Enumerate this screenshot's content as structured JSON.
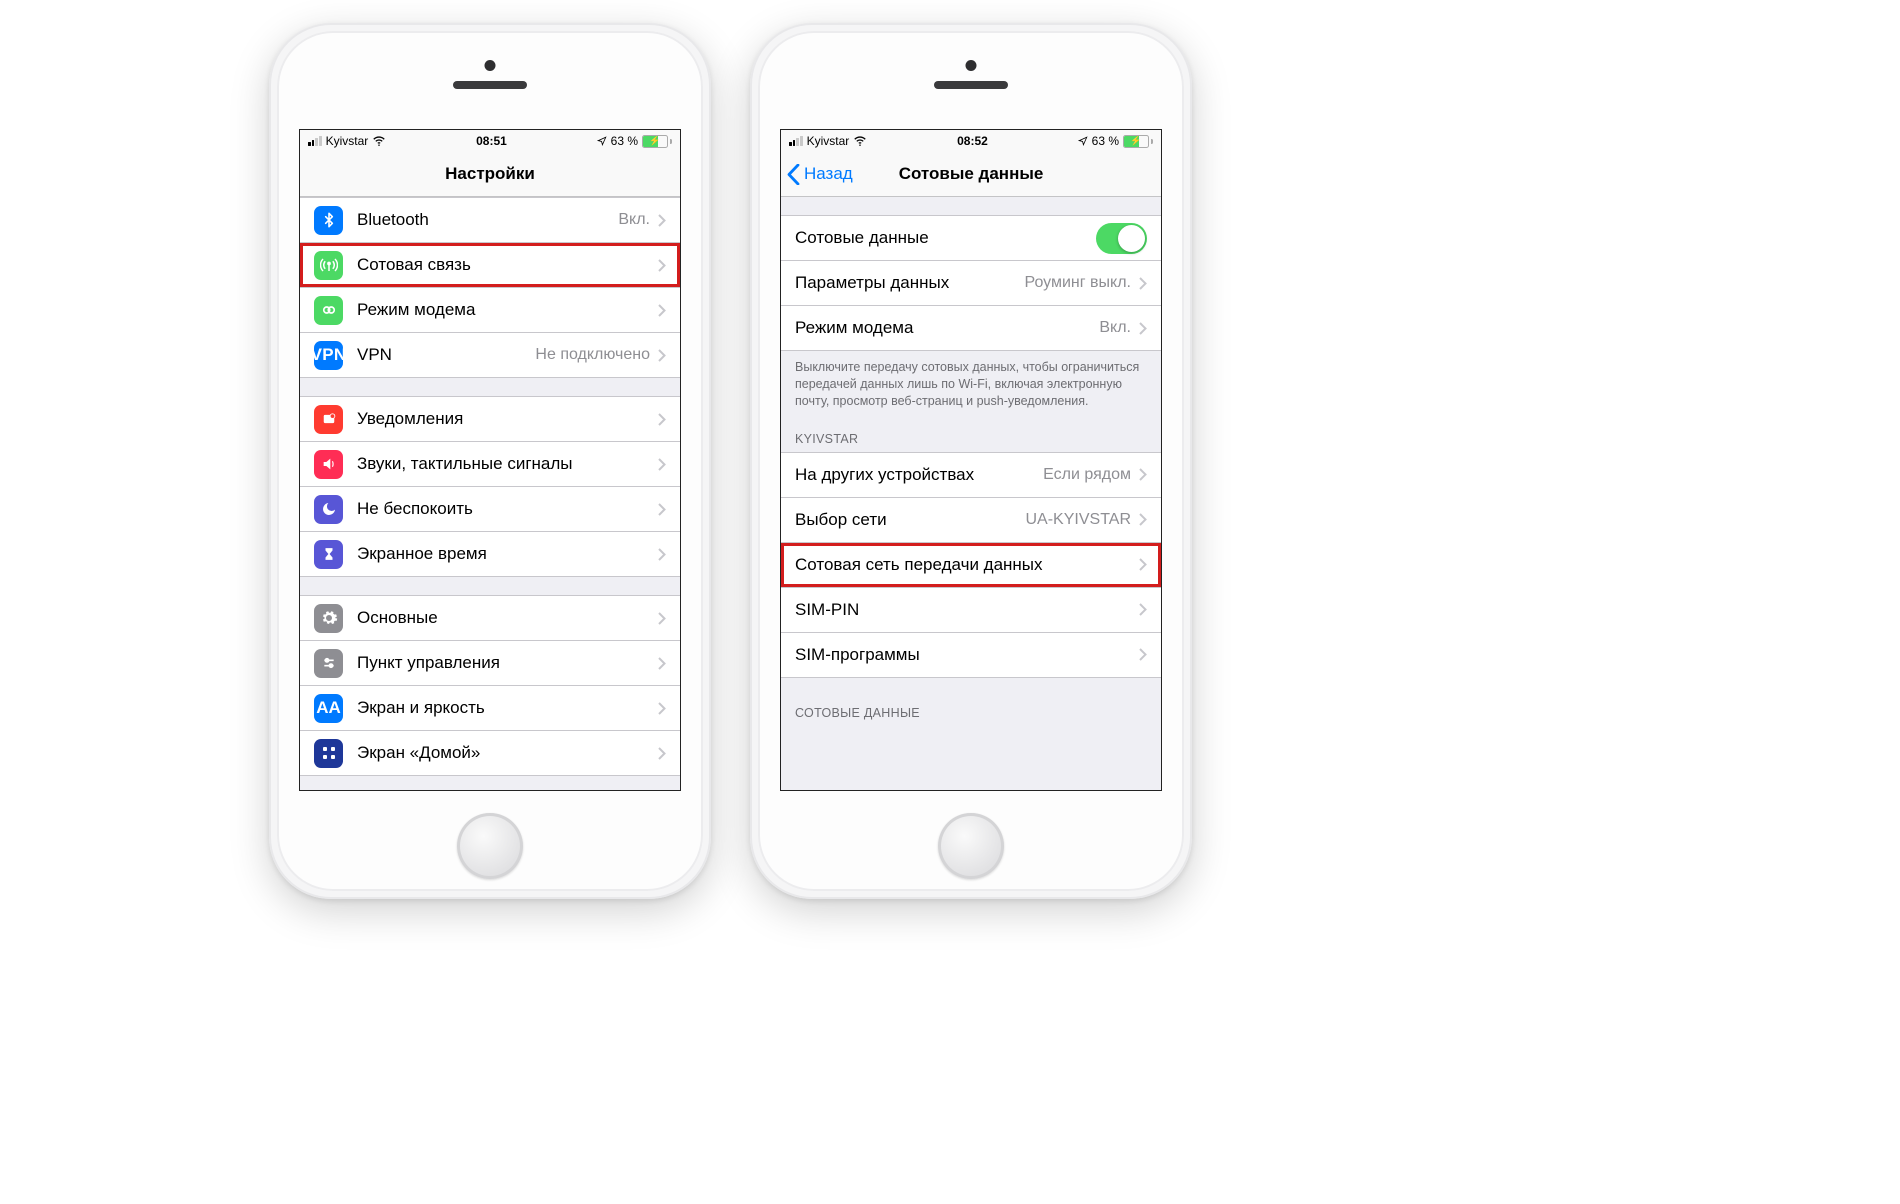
{
  "phone1": {
    "status": {
      "carrier": "Kyivstar",
      "time": "08:51",
      "battery": "63 %"
    },
    "nav": {
      "title": "Настройки"
    },
    "group1": [
      {
        "icon": "bluetooth",
        "label": "Bluetooth",
        "value": "Вкл."
      },
      {
        "icon": "cellular",
        "label": "Сотовая связь",
        "highlight": true
      },
      {
        "icon": "hotspot",
        "label": "Режим модема"
      },
      {
        "icon": "vpn",
        "label": "VPN",
        "value": "Не подключено"
      }
    ],
    "group2": [
      {
        "icon": "notif",
        "label": "Уведомления"
      },
      {
        "icon": "sound",
        "label": "Звуки, тактильные сигналы"
      },
      {
        "icon": "dnd",
        "label": "Не беспокоить"
      },
      {
        "icon": "screentime",
        "label": "Экранное время"
      }
    ],
    "group3": [
      {
        "icon": "general",
        "label": "Основные"
      },
      {
        "icon": "control",
        "label": "Пункт управления"
      },
      {
        "icon": "display",
        "label": "Экран и яркость"
      },
      {
        "icon": "home",
        "label": "Экран «Домой»"
      }
    ]
  },
  "phone2": {
    "status": {
      "carrier": "Kyivstar",
      "time": "08:52",
      "battery": "63 %"
    },
    "nav": {
      "back": "Назад",
      "title": "Сотовые данные"
    },
    "group1": {
      "cellular": {
        "label": "Сотовые данные",
        "on": true
      },
      "options": {
        "label": "Параметры данных",
        "value": "Роуминг выкл."
      },
      "hotspot": {
        "label": "Режим модема",
        "value": "Вкл."
      }
    },
    "note": "Выключите передачу сотовых данных, чтобы ограничиться передачей данных лишь по Wi-Fi, включая электронную почту, просмотр веб-страниц и push-уведомления.",
    "section2_header": "KYIVSTAR",
    "group2": [
      {
        "label": "На других устройствах",
        "value": "Если рядом"
      },
      {
        "label": "Выбор сети",
        "value": "UA-KYIVSTAR"
      },
      {
        "label": "Сотовая сеть передачи данных",
        "highlight": true
      },
      {
        "label": "SIM-PIN"
      },
      {
        "label": "SIM-программы"
      }
    ],
    "section3_header": "СОТОВЫЕ ДАННЫЕ"
  }
}
